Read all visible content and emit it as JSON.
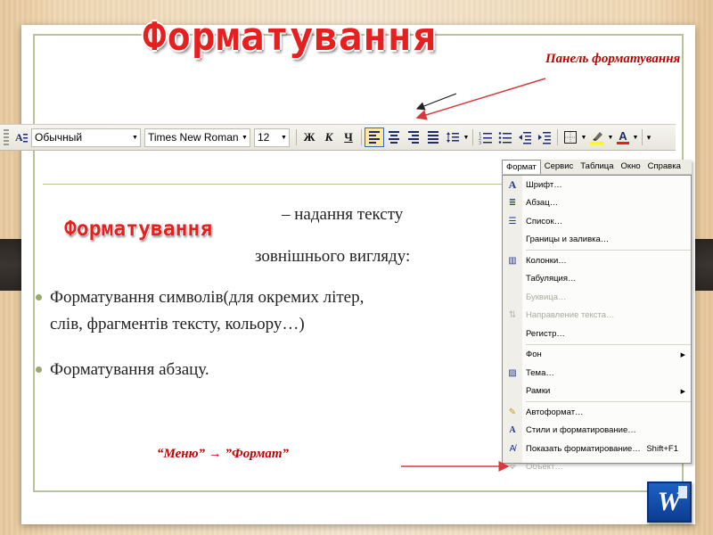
{
  "title": "Форматування",
  "panel_label": "Панель форматування",
  "toolbar": {
    "style_value": "Обычный",
    "font_value": "Times New Roman",
    "size_value": "12",
    "bold_label": "Ж",
    "italic_label": "К",
    "underline_label": "Ч",
    "font_color_label": "A"
  },
  "definition": {
    "term": "Форматування",
    "text_line1": "– надання тексту",
    "text_line2": "зовнішнього вигляду:"
  },
  "bullets": [
    {
      "line1": "Форматування символів(для окремих літер,",
      "line2": "слів, фрагментів тексту, кольору…)"
    },
    {
      "line1": "Форматування абзацу."
    }
  ],
  "menu_path": "“Меню” → ”Формат”",
  "menubar": [
    "Формат",
    "Сервис",
    "Таблица",
    "Окно",
    "Справка"
  ],
  "menu_items": [
    {
      "label": "Шрифт…",
      "icon": "font-icon"
    },
    {
      "label": "Абзац…",
      "icon": "paragraph-icon"
    },
    {
      "label": "Список…",
      "icon": "list-icon"
    },
    {
      "label": "Границы и заливка…",
      "icon": ""
    },
    {
      "label": "Колонки…",
      "icon": "columns-icon"
    },
    {
      "label": "Табуляция…",
      "icon": ""
    },
    {
      "label": "Буквица…",
      "icon": "",
      "disabled": true
    },
    {
      "label": "Направление текста…",
      "icon": "text-direction-icon",
      "disabled": true
    },
    {
      "label": "Регистр…",
      "icon": ""
    },
    {
      "label": "Фон",
      "icon": "",
      "submenu": true
    },
    {
      "label": "Тема…",
      "icon": "theme-icon"
    },
    {
      "label": "Рамки",
      "icon": "",
      "submenu": true
    },
    {
      "label": "Автоформат…",
      "icon": "autoformat-icon"
    },
    {
      "label": "Стили и форматирование…",
      "icon": "styles-icon"
    },
    {
      "label": "Показать форматирование…",
      "icon": "reveal-formatting-icon",
      "shortcut": "Shift+F1"
    },
    {
      "label": "Объект…",
      "icon": "object-icon",
      "disabled": true
    }
  ],
  "colors": {
    "title_red": "#e81f1f",
    "label_red": "#c00000",
    "frame_green": "#b9c39a",
    "word_blue": "#1c61c4"
  }
}
